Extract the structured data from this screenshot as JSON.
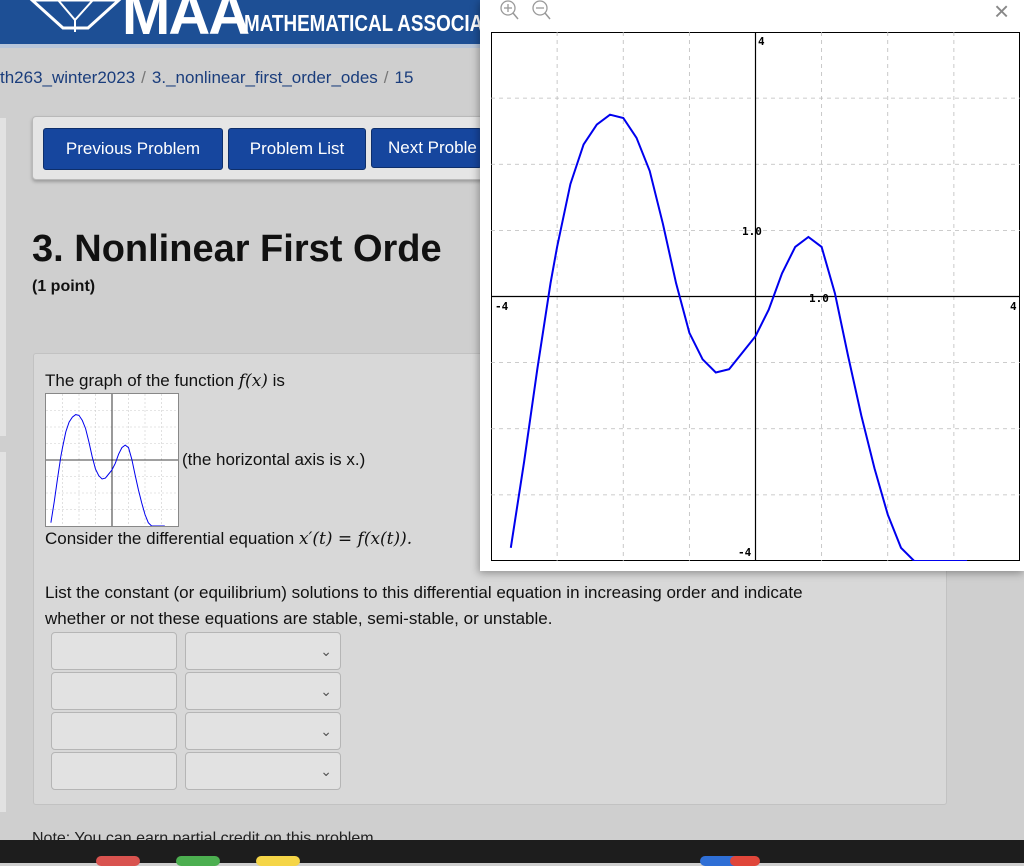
{
  "header": {
    "logo_text": "MAA",
    "org_name": "MATHEMATICAL ASSOCIATI"
  },
  "breadcrumb": {
    "course": "th263_winter2023",
    "set": "3._nonlinear_first_order_odes",
    "problem": "15"
  },
  "nav": {
    "previous": "Previous Problem",
    "list": "Problem List",
    "next": "Next Proble"
  },
  "problem": {
    "title": "3. Nonlinear First Orde",
    "points": "(1 point)",
    "graph_intro": "The graph of the function",
    "graph_fn": "f(x)",
    "graph_is": "is",
    "axis_note": "(the horizontal axis is x.)",
    "consider": "Consider the differential equation",
    "equation": "x′(t) = f(x(t)).",
    "instructions_line1": "List the constant (or equilibrium) solutions to this differential equation in increasing order and indicate",
    "instructions_line2": "whether or not these equations are stable, semi-stable, or unstable.",
    "answer_rows": [
      {
        "value": "",
        "stability": ""
      },
      {
        "value": "",
        "stability": ""
      },
      {
        "value": "",
        "stability": ""
      },
      {
        "value": "",
        "stability": ""
      }
    ]
  },
  "footer_text": "Note: You can earn partial credit on this problem.",
  "popup": {
    "zoom_in": "zoom-in-icon",
    "zoom_out": "zoom-out-icon",
    "close": "×"
  },
  "chart_data": {
    "type": "line",
    "xlim": [
      -4,
      4
    ],
    "ylim": [
      -4,
      4
    ],
    "grid": true,
    "tick_labels": {
      "x_min": "-4",
      "x_max": "4",
      "y_max": "4",
      "y_min": "-4",
      "x_mark": "1.0",
      "y_mark": "1.0"
    },
    "series": [
      {
        "color": "#0000ee",
        "x": [
          -3.7,
          -3.5,
          -3.3,
          -3.1,
          -3.0,
          -2.8,
          -2.6,
          -2.4,
          -2.2,
          -2.0,
          -1.8,
          -1.6,
          -1.4,
          -1.2,
          -1.0,
          -0.8,
          -0.6,
          -0.4,
          -0.2,
          0.0,
          0.2,
          0.4,
          0.6,
          0.8,
          1.0,
          1.2,
          1.4,
          1.6,
          1.8,
          2.0,
          2.2,
          2.4,
          2.6,
          2.8,
          3.0,
          3.2
        ],
        "y": [
          -3.8,
          -2.5,
          -1.1,
          0.2,
          0.75,
          1.7,
          2.3,
          2.6,
          2.75,
          2.7,
          2.4,
          1.9,
          1.1,
          0.2,
          -0.55,
          -0.95,
          -1.15,
          -1.1,
          -0.85,
          -0.6,
          -0.2,
          0.35,
          0.75,
          0.9,
          0.75,
          0.05,
          -0.9,
          -1.8,
          -2.6,
          -3.3,
          -3.8,
          -4.1,
          -4.3,
          -4.4,
          -4.5,
          -4.6
        ]
      }
    ]
  }
}
